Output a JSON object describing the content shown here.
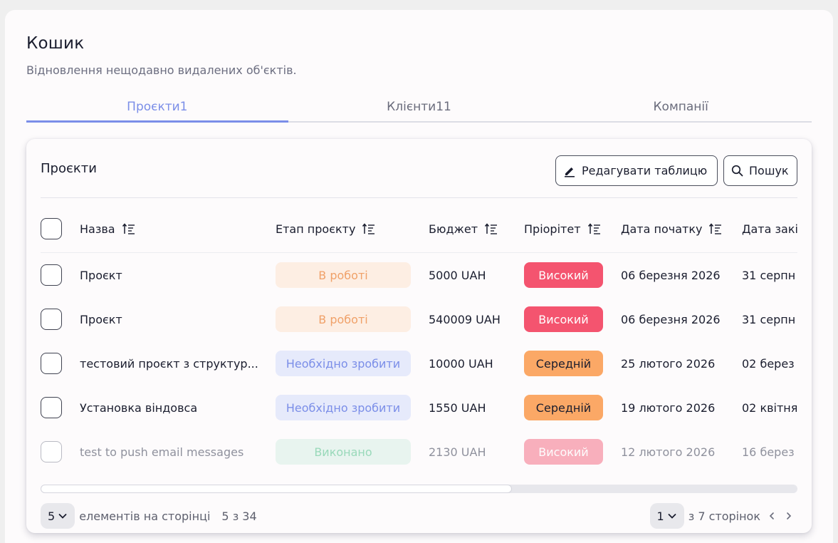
{
  "page": {
    "title": "Кошик",
    "subtitle": "Відновлення нещодавно видалених об'єктів."
  },
  "tabs": [
    {
      "label": "Проєкти1",
      "active": true
    },
    {
      "label": "Клієнти11",
      "active": false
    },
    {
      "label": "Компанії",
      "active": false
    }
  ],
  "card": {
    "title": "Проєкти",
    "edit_button": "Редагувати таблицю",
    "search_button": "Пошук",
    "edit_icon": "pencil-icon",
    "search_icon": "search-icon"
  },
  "columns": [
    "Назва",
    "Етап проєкту",
    "Бюджет",
    "Пріорітет",
    "Дата початку",
    "Дата закі"
  ],
  "rows": [
    {
      "name": "Проєкт",
      "stage": "В роботі",
      "stage_kind": "in-progress",
      "budget": "5000 UAH",
      "priority": "Високий",
      "priority_kind": "high",
      "start": "06 березня 2026",
      "end": "31 серпн",
      "faded": false
    },
    {
      "name": "Проєкт",
      "stage": "В роботі",
      "stage_kind": "in-progress",
      "budget": "540009 UAH",
      "priority": "Високий",
      "priority_kind": "high",
      "start": "06 березня 2026",
      "end": "31 серпн",
      "faded": false
    },
    {
      "name": "тестовий проєкт з структур...",
      "stage": "Необхідно зробити",
      "stage_kind": "todo",
      "budget": "10000 UAH",
      "priority": "Середній",
      "priority_kind": "medium",
      "start": "25 лютого 2026",
      "end": "02 берез",
      "faded": false
    },
    {
      "name": "Установка віндовса",
      "stage": "Необхідно зробити",
      "stage_kind": "todo",
      "budget": "1550 UAH",
      "priority": "Середній",
      "priority_kind": "medium",
      "start": "19 лютого 2026",
      "end": "02 квітня",
      "faded": false
    },
    {
      "name": "test to push email messages",
      "stage": "Виконано",
      "stage_kind": "done",
      "budget": "2130 UAH",
      "priority": "Високий",
      "priority_kind": "high",
      "start": "12 лютого 2026",
      "end": "16 берез",
      "faded": true
    }
  ],
  "colors": {
    "accent": "#7b8ee8",
    "in-progress": {
      "bg": "#fdeee3",
      "fg": "#f0a169"
    },
    "todo": {
      "bg": "#e6eafb",
      "fg": "#7b8ee8"
    },
    "done": {
      "bg": "#e6f4ee",
      "fg": "#8fd6b3"
    },
    "high": {
      "bg": "#f4546f",
      "fg": "#ffffff"
    },
    "medium": {
      "bg": "#fba866",
      "fg": "#1a1d2e"
    }
  },
  "footer": {
    "page_size": "5",
    "page_size_label": "елементів на сторінці",
    "range": "5 з 34",
    "current_page": "1",
    "pages_label": "з 7 сторінок"
  }
}
